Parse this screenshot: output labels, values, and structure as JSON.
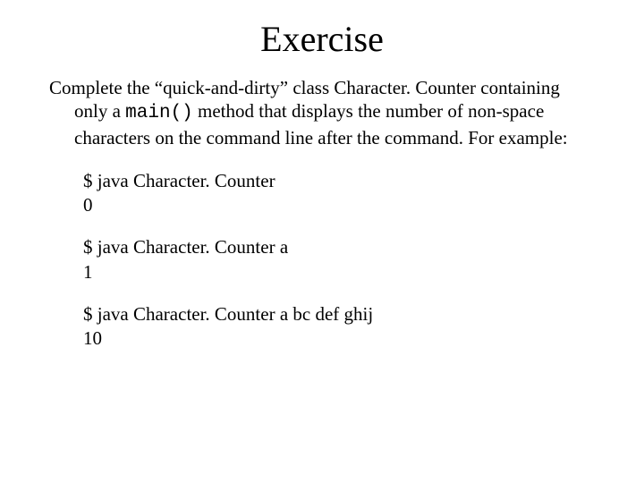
{
  "title": "Exercise",
  "paragraph": {
    "pre": "Complete the “quick-and-dirty” class  Character. Counter containing only a ",
    "mono": "main()",
    "post": " method that displays the number of non-space characters on the command line after the command.  For example:"
  },
  "examples": [
    {
      "cmd": "$ java Character. Counter",
      "out": "0"
    },
    {
      "cmd": "$ java Character. Counter a",
      "out": "1"
    },
    {
      "cmd": "$ java Character. Counter a bc def ghij",
      "out": "10"
    }
  ]
}
